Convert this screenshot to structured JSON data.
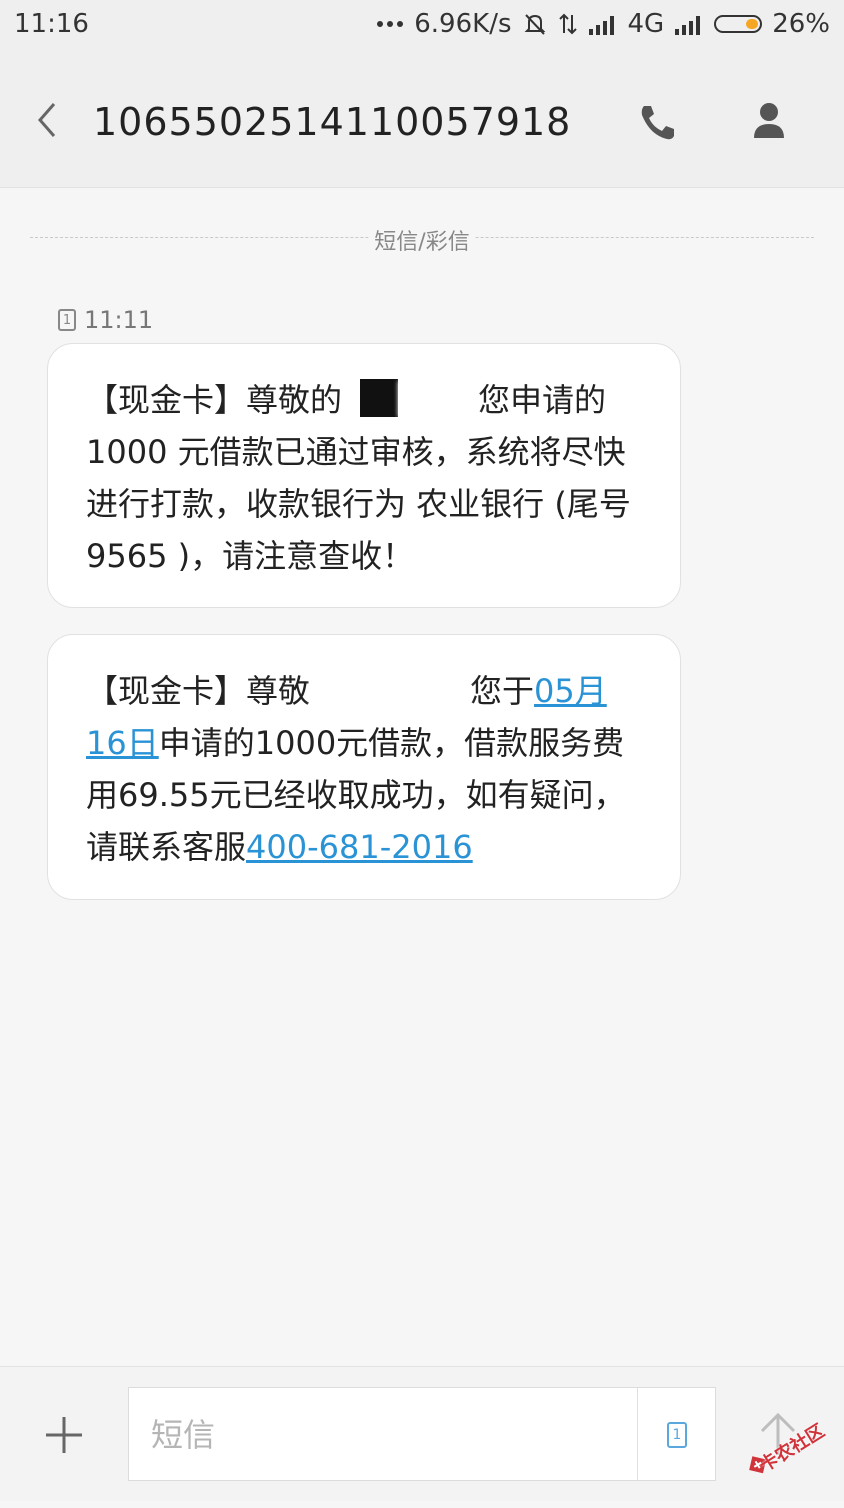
{
  "status_bar": {
    "time": "11:16",
    "network_speed": "6.96K/s",
    "network_type": "4G",
    "battery_percent": "26%",
    "battery_level": 0.26,
    "icons": [
      "more-dots-icon",
      "mute-bell-icon",
      "data-arrows-icon",
      "signal-icon",
      "signal-icon",
      "battery-icon"
    ]
  },
  "header": {
    "title": "1065502514110057918",
    "icons": [
      "back-arrow-icon",
      "phone-icon",
      "contact-icon"
    ]
  },
  "conversation": {
    "divider_label": "短信/彩信",
    "sim_slot": "1",
    "message_time": "11:11",
    "messages": [
      {
        "part_1": "【现金卡】尊敬的",
        "part_2": "您申请的1000 元借款已通过审核，系统将尽快进行打款，收款银行为 农业银行 (尾号9565 )，请注意查收！"
      },
      {
        "part_1": "【现金卡】尊敬",
        "part_2": "您于",
        "link_date": "05月16日",
        "part_3": "申请的1000元借款，借款服务费用69.55元已经收取成功，如有疑问，请联系客服",
        "link_phone": "400-681-2016"
      }
    ]
  },
  "composer": {
    "placeholder": "短信",
    "sim_slot": "1",
    "icons": [
      "plus-icon",
      "sim-icon",
      "send-arrow-icon"
    ]
  },
  "watermark": {
    "text": "卡农社区"
  },
  "colors": {
    "background": "#f6f6f6",
    "header": "#efefef",
    "bubble": "#ffffff",
    "link": "#2a93d5",
    "battery": "#f5a623"
  }
}
